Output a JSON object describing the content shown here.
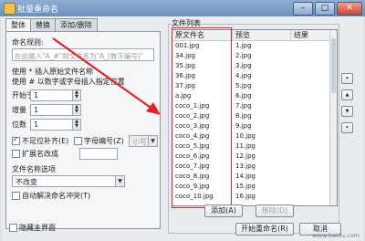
{
  "window": {
    "title": "批量重命名"
  },
  "tabs": [
    "整体",
    "替换",
    "添加/删除"
  ],
  "rule": {
    "label": "命名规则:",
    "placeholder": "在此输入\"A_#\"则文件名为\"A_(数字编号)\"",
    "hint1": "使用 * 插入原始文件名称",
    "hint2": "使用 # 以数字或字母插入指定位置"
  },
  "start": {
    "label": "开始于",
    "value": "1"
  },
  "step": {
    "label": "增量",
    "value": "1"
  },
  "digits": {
    "label": "位数",
    "value": "1"
  },
  "options": {
    "pad_zero": "不足位补齐(E)",
    "letter_number": "字母编号(Z)",
    "case_value": "小写",
    "ext_change": "扩展名改成",
    "filename_options_label": "文件名称选项",
    "filename_option_value": "不改变",
    "auto_resolve": "自动解决命名冲突(T)",
    "hide_main": "隐藏主界面"
  },
  "file_list": {
    "group_title": "文件列表",
    "columns": [
      "原文件名",
      "预览",
      "结果"
    ],
    "original": [
      "001.jpg",
      "34.jpg",
      "35.jpg",
      "36.jpg",
      "37.jpg",
      "a.jpg",
      "coco_1.jpg",
      "coco_2.jpg",
      "coco_3.jpg",
      "coco_4.jpg",
      "coco_5.jpg",
      "coco_6.jpg",
      "coco_7.jpg",
      "coco_8.jpg",
      "coco_9.jpg",
      "coco_10.jpg"
    ],
    "preview": [
      "1.jpg",
      "2.jpg",
      "3.jpg",
      "4.jpg",
      "5.jpg",
      "6.jpg",
      "7.jpg",
      "8.jpg",
      "9.jpg",
      "10.jpg",
      "11.jpg",
      "12.jpg",
      "13.jpg",
      "14.jpg",
      "15.jpg",
      "16.jpg"
    ]
  },
  "buttons": {
    "add": "添加(A)",
    "remove": "移除(D)",
    "start": "开始重命名(R)",
    "cancel": "取消"
  },
  "watermark": "www.baidu.com",
  "colors": {
    "annotation_red": "#e0242b",
    "titlebar": "#6c90bb"
  }
}
